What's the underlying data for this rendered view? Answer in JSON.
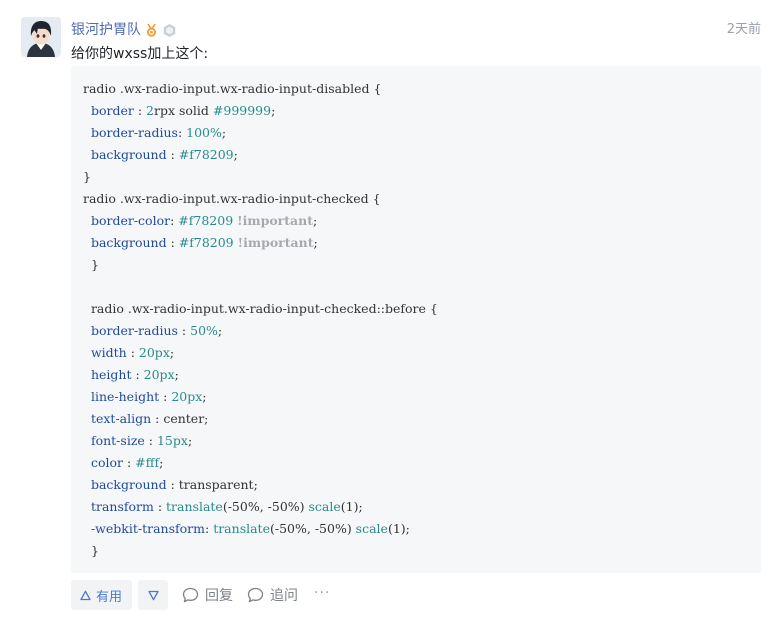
{
  "answer": {
    "author": "银河护胃队",
    "time": "2天前",
    "intro": "给你的wxss加上这个:",
    "badges": [
      "medal-badge-icon",
      "level-badge-icon"
    ],
    "code_lines": [
      [
        [
          "radio .wx-radio-input.wx-radio-input-disabled {",
          "plain"
        ]
      ],
      [
        [
          "  ",
          "plain"
        ],
        [
          "border",
          "prop"
        ],
        [
          " : ",
          "plain"
        ],
        [
          "2",
          "val"
        ],
        [
          "rpx solid ",
          "plain"
        ],
        [
          "#999999",
          "val"
        ],
        [
          ";",
          "plain"
        ]
      ],
      [
        [
          "  ",
          "plain"
        ],
        [
          "border-radius",
          "prop"
        ],
        [
          ": ",
          "plain"
        ],
        [
          "100%",
          "val"
        ],
        [
          ";",
          "plain"
        ]
      ],
      [
        [
          "  ",
          "plain"
        ],
        [
          "background",
          "prop"
        ],
        [
          " : ",
          "plain"
        ],
        [
          "#f78209",
          "val"
        ],
        [
          ";",
          "plain"
        ]
      ],
      [
        [
          "}",
          "plain"
        ]
      ],
      [
        [
          "radio .wx-radio-input.wx-radio-input-checked {",
          "plain"
        ]
      ],
      [
        [
          "  ",
          "plain"
        ],
        [
          "border-color",
          "prop"
        ],
        [
          ": ",
          "plain"
        ],
        [
          "#f78209",
          "val"
        ],
        [
          " ",
          "plain"
        ],
        [
          "!important",
          "imp"
        ],
        [
          ";",
          "plain"
        ]
      ],
      [
        [
          "  ",
          "plain"
        ],
        [
          "background",
          "prop"
        ],
        [
          " : ",
          "plain"
        ],
        [
          "#f78209",
          "val"
        ],
        [
          " ",
          "plain"
        ],
        [
          "!important",
          "imp"
        ],
        [
          ";",
          "plain"
        ]
      ],
      [
        [
          "  }",
          "plain"
        ]
      ],
      [
        [
          "",
          "plain"
        ]
      ],
      [
        [
          "  radio .wx-radio-input.wx-radio-input-checked::before {",
          "plain"
        ]
      ],
      [
        [
          "  ",
          "plain"
        ],
        [
          "border-radius",
          "prop"
        ],
        [
          " : ",
          "plain"
        ],
        [
          "50%",
          "val"
        ],
        [
          ";",
          "plain"
        ]
      ],
      [
        [
          "  ",
          "plain"
        ],
        [
          "width",
          "prop"
        ],
        [
          " : ",
          "plain"
        ],
        [
          "20px",
          "val"
        ],
        [
          ";",
          "plain"
        ]
      ],
      [
        [
          "  ",
          "plain"
        ],
        [
          "height",
          "prop"
        ],
        [
          " : ",
          "plain"
        ],
        [
          "20px",
          "val"
        ],
        [
          ";",
          "plain"
        ]
      ],
      [
        [
          "  ",
          "plain"
        ],
        [
          "line-height",
          "prop"
        ],
        [
          " : ",
          "plain"
        ],
        [
          "20px",
          "val"
        ],
        [
          ";",
          "plain"
        ]
      ],
      [
        [
          "  ",
          "plain"
        ],
        [
          "text-align",
          "prop"
        ],
        [
          " : center;",
          "plain"
        ]
      ],
      [
        [
          "  ",
          "plain"
        ],
        [
          "font-size",
          "prop"
        ],
        [
          " : ",
          "plain"
        ],
        [
          "15px",
          "val"
        ],
        [
          ";",
          "plain"
        ]
      ],
      [
        [
          "  ",
          "plain"
        ],
        [
          "color",
          "prop"
        ],
        [
          " : ",
          "plain"
        ],
        [
          "#fff",
          "val"
        ],
        [
          ";",
          "plain"
        ]
      ],
      [
        [
          "  ",
          "plain"
        ],
        [
          "background",
          "prop"
        ],
        [
          " : transparent;",
          "plain"
        ]
      ],
      [
        [
          "  ",
          "plain"
        ],
        [
          "transform",
          "prop"
        ],
        [
          " : ",
          "plain"
        ],
        [
          "translate",
          "fn"
        ],
        [
          "(-50%, -50%) ",
          "plain"
        ],
        [
          "scale",
          "fn"
        ],
        [
          "(1);",
          "plain"
        ]
      ],
      [
        [
          "  ",
          "plain"
        ],
        [
          "-webkit-transform",
          "prop"
        ],
        [
          ": ",
          "plain"
        ],
        [
          "translate",
          "fn"
        ],
        [
          "(-50%, -50%) ",
          "plain"
        ],
        [
          "scale",
          "fn"
        ],
        [
          "(1);",
          "plain"
        ]
      ],
      [
        [
          "  }",
          "plain"
        ]
      ]
    ]
  },
  "actions": {
    "useful_label": "有用",
    "reply_label": "回复",
    "ask_label": "追问",
    "more_label": "···"
  },
  "colors": {
    "author": "#4f6bb0",
    "accent_blue": "#4a7bd0",
    "code_bg": "#f6f7f8",
    "prop": "#1e4a9b",
    "value": "#2a8a8c",
    "important": "#a5a9ae"
  }
}
